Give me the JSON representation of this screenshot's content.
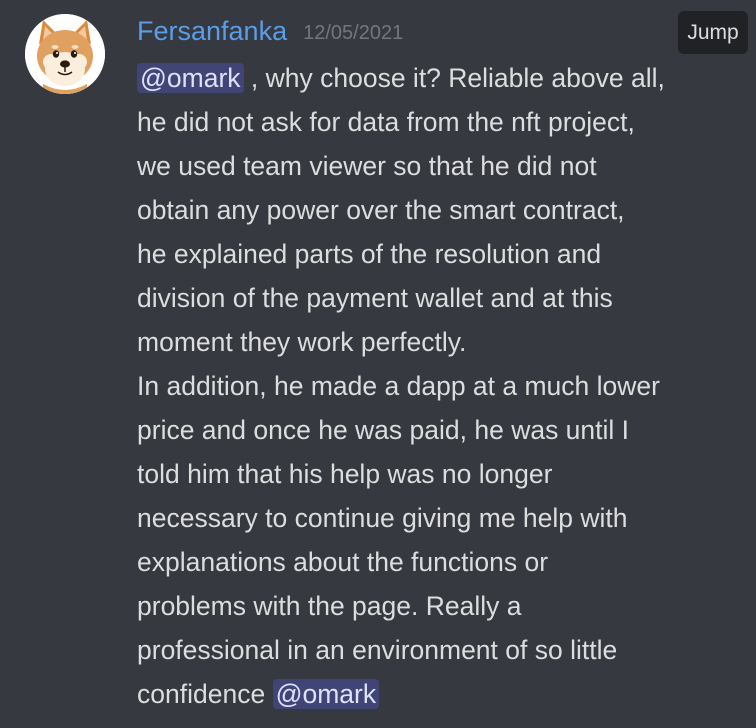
{
  "message": {
    "username": "Fersanfanka",
    "timestamp": "12/05/2021",
    "jump_label": "Jump",
    "mention": "@omark",
    "lines": [
      ", why choose it? Reliable above all,",
      "he did not ask for data from the nft project,",
      "we used team viewer so that he did not",
      "obtain any power over the smart contract,",
      "he explained parts of the resolution and",
      "division of the payment wallet and at this",
      "moment they work perfectly.",
      "In addition, he made a dapp at a much lower",
      "price and once he was paid, he was until I",
      "told him that his help was no longer",
      "necessary to continue giving me help with",
      "explanations about the functions or",
      "problems with the page. Really a",
      "professional in an environment of so little",
      "confidence"
    ],
    "mention_end": "@omark"
  },
  "colors": {
    "background": "#36393f",
    "username": "#5a9de8",
    "timestamp": "#72767d",
    "text": "#dcddde",
    "mention_bg": "rgba(88,101,242,0.3)",
    "mention_text": "#dee0fc",
    "jump_bg": "#202225"
  },
  "icons": {
    "avatar": "shiba-inu-dog-avatar"
  }
}
